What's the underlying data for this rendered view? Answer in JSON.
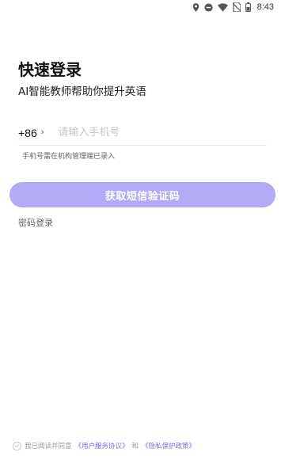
{
  "status_bar": {
    "time": "8:43",
    "icons": [
      "location-icon",
      "do-not-disturb-icon",
      "wifi-icon",
      "no-sim-icon",
      "battery-icon"
    ]
  },
  "header": {
    "title": "快速登录",
    "subtitle": "AI智能教师帮助你提升英语"
  },
  "phone": {
    "country_code": "+86",
    "chevron": "›",
    "placeholder": "请输入手机号",
    "value": "",
    "hint": "手机号需在机构管理端已录入"
  },
  "actions": {
    "get_code_label": "获取短信验证码",
    "password_login_label": "密码登录"
  },
  "agreement": {
    "prefix": "我已阅读并同意",
    "user_agreement": "《用户服务协议》",
    "conjunction": "和",
    "privacy_policy": "《隐私保护政策》"
  },
  "colors": {
    "accent": "#b3aaf5",
    "link": "#7b6fe0",
    "hint_text": "#666666",
    "placeholder": "#c6c6c6"
  }
}
